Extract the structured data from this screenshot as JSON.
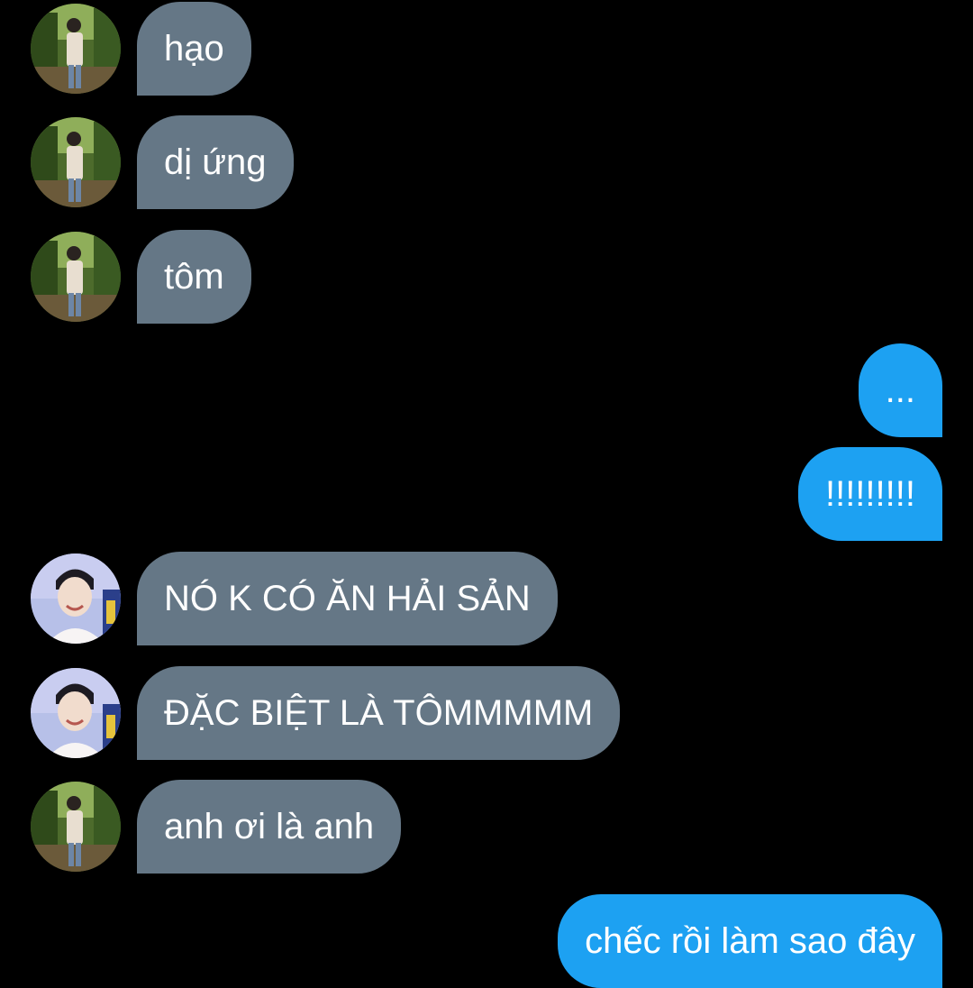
{
  "conversation": {
    "messages": [
      {
        "sender": "contact",
        "avatar": "avatar-outdoor",
        "text": "hạo"
      },
      {
        "sender": "contact",
        "avatar": "avatar-outdoor",
        "text": "dị ứng"
      },
      {
        "sender": "contact",
        "avatar": "avatar-outdoor",
        "text": "tôm"
      },
      {
        "sender": "me",
        "text": "..."
      },
      {
        "sender": "me",
        "text": "!!!!!!!!!"
      },
      {
        "sender": "contact",
        "avatar": "avatar-smiling",
        "text": "NÓ K CÓ ĂN HẢI SẢN"
      },
      {
        "sender": "contact",
        "avatar": "avatar-smiling",
        "text": "ĐẶC BIỆT LÀ TÔMMMMM"
      },
      {
        "sender": "contact",
        "avatar": "avatar-outdoor",
        "text": "anh ơi là anh"
      },
      {
        "sender": "me",
        "text": "chếc rồi làm sao đây"
      }
    ]
  },
  "colors": {
    "background": "#000000",
    "incoming_bubble": "#657786",
    "outgoing_bubble": "#1da1f2",
    "text": "#ffffff"
  }
}
